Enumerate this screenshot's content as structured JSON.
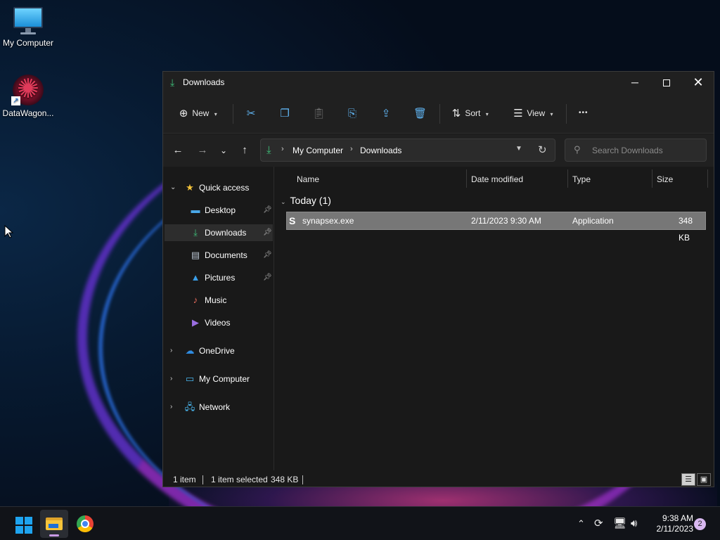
{
  "desktop": {
    "icons": [
      {
        "label": "My Computer",
        "icon": "monitor-icon"
      },
      {
        "label": "DataWagon...",
        "icon": "datawagon-icon"
      }
    ]
  },
  "window": {
    "title": "Downloads",
    "title_icon": "download-icon",
    "controls": {
      "minimize": "─",
      "close": "✕"
    }
  },
  "toolbar": {
    "new_label": "New",
    "sort_label": "Sort",
    "view_label": "View",
    "more": "•••",
    "icons": [
      "cut-icon",
      "copy-icon",
      "paste-icon",
      "rename-icon",
      "share-icon",
      "delete-icon"
    ]
  },
  "navigation": {
    "back": "←",
    "forward": "→",
    "recent": "⌄",
    "up": "↑",
    "breadcrumb": [
      "My Computer",
      "Downloads"
    ],
    "search_placeholder": "Search Downloads"
  },
  "sidebar": {
    "items": [
      {
        "label": "Quick access",
        "icon": "star-icon"
      },
      {
        "label": "Desktop",
        "icon": "desktop-folder-icon",
        "pinned": true
      },
      {
        "label": "Downloads",
        "icon": "download-icon",
        "pinned": true,
        "selected": true
      },
      {
        "label": "Documents",
        "icon": "documents-icon",
        "pinned": true
      },
      {
        "label": "Pictures",
        "icon": "pictures-icon",
        "pinned": true
      },
      {
        "label": "Music",
        "icon": "music-icon"
      },
      {
        "label": "Videos",
        "icon": "videos-icon"
      },
      {
        "label": "OneDrive",
        "icon": "cloud-icon"
      },
      {
        "label": "My Computer",
        "icon": "monitor-icon"
      },
      {
        "label": "Network",
        "icon": "network-icon"
      }
    ]
  },
  "files": {
    "columns": [
      "Name",
      "Date modified",
      "Type",
      "Size"
    ],
    "group": "Today (1)",
    "rows": [
      {
        "name": "synapsex.exe",
        "date_modified": "2/11/2023 9:30 AM",
        "type": "Application",
        "size": "348 KB"
      }
    ]
  },
  "status": {
    "item_count": "1 item",
    "selected": "1 item selected",
    "selected_size": "348 KB"
  },
  "taskbar": {
    "apps": [
      "windows-start-icon",
      "file-explorer-icon",
      "chrome-icon"
    ],
    "tray_icons": [
      "chevron-up-icon",
      "sync-icon",
      "network-icon",
      "volume-icon"
    ],
    "time": "9:38 AM",
    "date": "2/11/2023",
    "notification_count": "2"
  },
  "colors": {
    "accent_green": "#3fc17a",
    "accent_blue": "#1ea4f0",
    "window_bg": "#191919",
    "selected_row": "#777777"
  }
}
